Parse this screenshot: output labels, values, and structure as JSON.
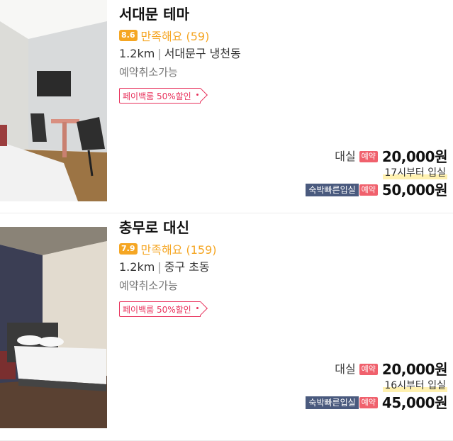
{
  "listings": [
    {
      "name": "서대문 테마",
      "score": "8.6",
      "review_text": "만족해요 (59)",
      "distance": "1.2km",
      "separator": "|",
      "area": "서대문구 냉천동",
      "cancel": "예약취소가능",
      "coupon": "페이백룸 50%할인",
      "day_label": "대실",
      "reserve_badge": "예약",
      "day_price": "20,000원",
      "checkin": "17시부터 입실",
      "stay_badge": "숙박빠른입실",
      "stay_price": "50,000원"
    },
    {
      "name": "충무로 대신",
      "score": "7.9",
      "review_text": "만족해요 (159)",
      "distance": "1.2km",
      "separator": "|",
      "area": "중구 초동",
      "cancel": "예약취소가능",
      "coupon": "페이백룸 50%할인",
      "day_label": "대실",
      "reserve_badge": "예약",
      "day_price": "20,000원",
      "checkin": "16시부터 입실",
      "stay_badge": "숙박빠른입실",
      "stay_price": "45,000원"
    }
  ],
  "colors": {
    "score_bg": "#f5a623",
    "coupon": "#e8325c",
    "reserve_badge": "#f0616d",
    "stay_badge": "#4a5a7e",
    "checkin_highlight": "#fff1b0"
  }
}
